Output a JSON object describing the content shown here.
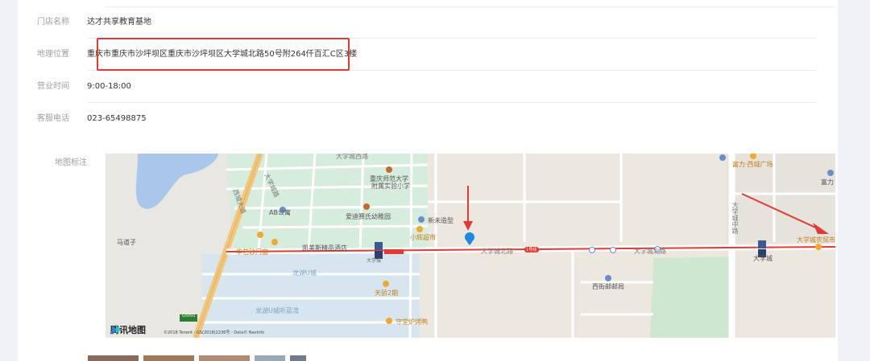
{
  "store": {
    "name_label": "门店名称",
    "name_value": "达才共享教育基地",
    "location_label": "地理位置",
    "location_value": "重庆市重庆市沙坪坝区重庆市沙坪坝区大学城北路50号附264仟百汇C区3楼",
    "hours_label": "营业时间",
    "hours_value": "9:00-18:00",
    "phone_label": "客服电话",
    "phone_value": "023-65498875",
    "map_label": "地图标注"
  },
  "map": {
    "provider": "腾讯地图",
    "copyright": "©2018 Tenent - GS(2018)2236号 - Data© NavInfo",
    "places": {
      "school": "重庆师范大学附属实验小学",
      "school_l1": "重庆师范大学",
      "school_l2": "附属实验小学",
      "ab_apartment": "AB公寓",
      "kindergarten": "爱迪赛氏幼稚园",
      "new_style": "新未造型",
      "supermarket": "小辉超市",
      "mazizi": "马道子",
      "hotel": "凯美斯精品酒店",
      "gate": "华艺砂门窗",
      "tian_guo": "天骄2期",
      "longhu_u": "龙湖U城",
      "longhu_u_street": "龙湖U城听蓝湾",
      "roast": "守堂炉烤鸭",
      "university_post": "西街邮邮局",
      "fuli_square": "富力·西城广场",
      "fuli": "富力",
      "daxuecheng_market": "大学城农贸市",
      "daxuecheng": "大学城",
      "metro_station": "大学城",
      "station_guang": "大学城",
      "road_north_1": "大学城北路",
      "road_north_2": "大学城北路",
      "road_middle": "大学城中路",
      "road_westcity": "西城大道",
      "road_left": "大学城路",
      "road_top": "大学城西路",
      "hotel_short": "大学城"
    },
    "badges": {
      "g5001": "G5001",
      "metro": "1",
      "road_tag": "1号线"
    },
    "icons": [
      "map-pin-icon",
      "arrow-icon"
    ]
  },
  "colors": {
    "highlight": "#e53935",
    "pin": "#1e88e5",
    "road_main": "#f0c67a",
    "metro": "#e53935",
    "water": "#a8c7ea",
    "green": "#cde8cf"
  }
}
